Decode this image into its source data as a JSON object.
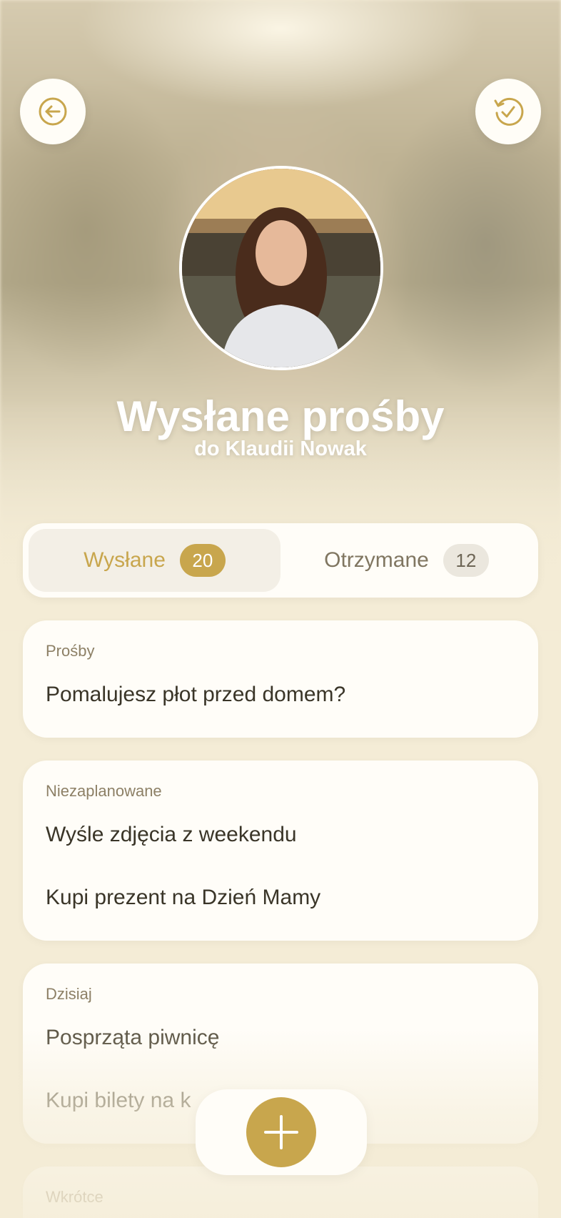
{
  "header": {
    "title": "Wysłane prośby",
    "subtitle": "do Klaudii Nowak",
    "back_icon": "back-arrow-icon",
    "history_icon": "history-check-icon"
  },
  "tabs": [
    {
      "label": "Wysłane",
      "count": "20",
      "active": true
    },
    {
      "label": "Otrzymane",
      "count": "12",
      "active": false
    }
  ],
  "sections": [
    {
      "header": "Prośby",
      "items": [
        "Pomalujesz płot przed domem?"
      ]
    },
    {
      "header": "Niezaplanowane",
      "items": [
        "Wyśle zdjęcia z weekendu",
        "Kupi prezent na Dzień Mamy"
      ]
    },
    {
      "header": "Dzisiaj",
      "items": [
        "Posprząta piwnicę",
        "Kupi bilety na k"
      ]
    },
    {
      "header": "Wkrótce",
      "items": []
    }
  ],
  "fab": {
    "icon": "plus-icon"
  },
  "colors": {
    "accent": "#c8a64d",
    "background": "#f4ecd6",
    "card": "#fffdf8",
    "text": "#3a3528"
  }
}
